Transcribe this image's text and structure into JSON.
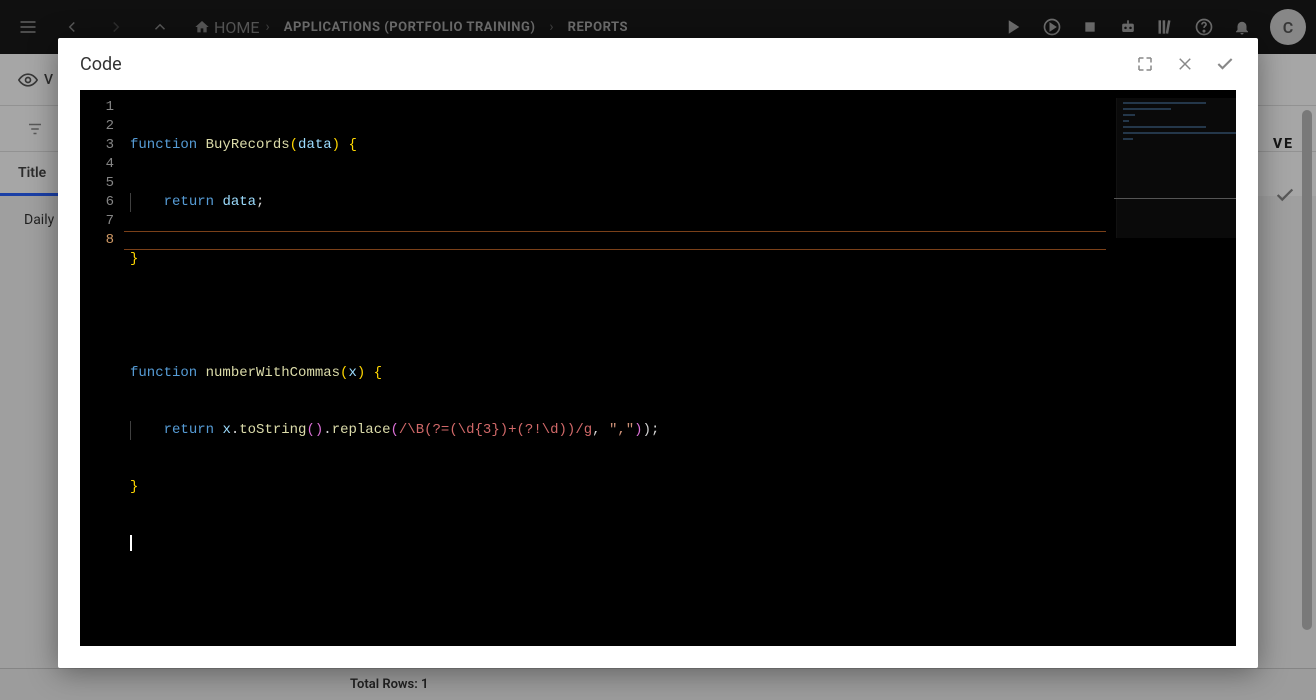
{
  "header": {
    "home_label": "HOME",
    "breadcrumbs": [
      "APPLICATIONS (PORTFOLIO TRAINING)",
      "REPORTS"
    ],
    "avatar_initial": "C"
  },
  "background": {
    "view_label": "V",
    "tab_title": "Title",
    "list_item": "Daily",
    "total_rows": "Total Rows: 1",
    "brand_fragment": "VE"
  },
  "modal": {
    "title": "Code"
  },
  "editor": {
    "line_numbers": [
      "1",
      "2",
      "3",
      "4",
      "5",
      "6",
      "7",
      "8"
    ],
    "current_line_index": 7,
    "code": {
      "l1": {
        "kw": "function",
        "fn": "BuyRecords",
        "param": "data",
        "brace": "{"
      },
      "l2": {
        "kw": "return",
        "var": "data",
        "semi": ";"
      },
      "l3": {
        "brace": "}"
      },
      "l4": "",
      "l5": {
        "kw": "function",
        "fn": "numberWithCommas",
        "param": "x",
        "brace": "{"
      },
      "l6": {
        "kw": "return",
        "var": "x",
        "m1": "toString",
        "m2": "replace",
        "regex": "/\\B(?=(\\d{3})+(?!\\d))/g",
        "str": "\",\"",
        "tail": ");"
      },
      "l7": {
        "brace": "}"
      }
    }
  }
}
